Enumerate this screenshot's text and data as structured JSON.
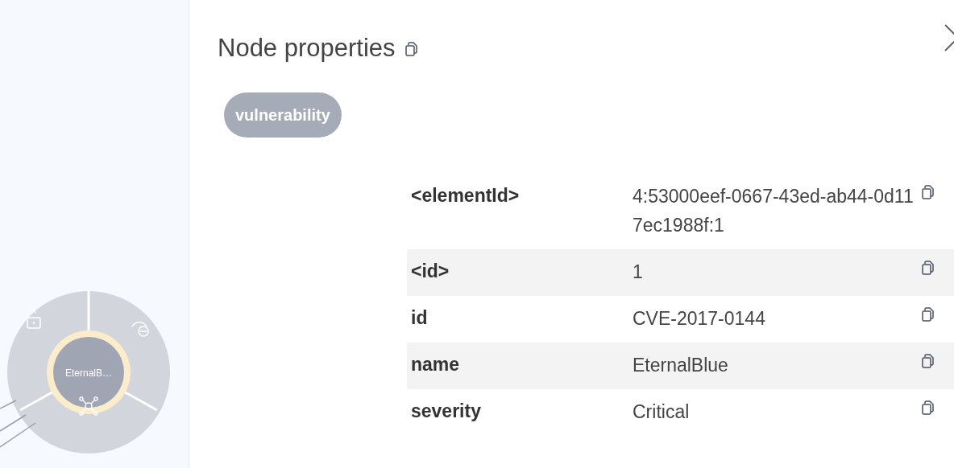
{
  "graph": {
    "node": {
      "label": "EternalB…"
    }
  },
  "panel": {
    "title": "Node properties",
    "labels": [
      "vulnerability"
    ],
    "properties": [
      {
        "key": "<elementId>",
        "value": "4:53000eef-0667-43ed-ab44-0d117ec1988f:1"
      },
      {
        "key": "<id>",
        "value": "1"
      },
      {
        "key": "id",
        "value": "CVE-2017-0144"
      },
      {
        "key": "name",
        "value": "EternalBlue"
      },
      {
        "key": "severity",
        "value": "Critical"
      }
    ]
  }
}
